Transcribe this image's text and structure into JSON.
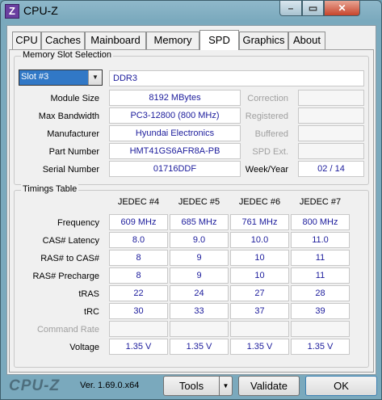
{
  "window": {
    "title": "CPU-Z",
    "icon_letter": "Z"
  },
  "window_controls": {
    "minimize": "–",
    "maximize": "▭",
    "close": "✕"
  },
  "tabs": [
    "CPU",
    "Caches",
    "Mainboard",
    "Memory",
    "SPD",
    "Graphics",
    "About"
  ],
  "active_tab": "SPD",
  "memory_slot": {
    "group_title": "Memory Slot Selection",
    "slot_selected": "Slot #3",
    "type": "DDR3",
    "rows": [
      {
        "label": "Module Size",
        "value": "8192 MBytes"
      },
      {
        "label": "Max Bandwidth",
        "value": "PC3-12800 (800 MHz)"
      },
      {
        "label": "Manufacturer",
        "value": "Hyundai Electronics"
      },
      {
        "label": "Part Number",
        "value": "HMT41GS6AFR8A-PB"
      },
      {
        "label": "Serial Number",
        "value": "01716DDF"
      }
    ],
    "right_rows": [
      {
        "label": "Correction",
        "value": ""
      },
      {
        "label": "Registered",
        "value": ""
      },
      {
        "label": "Buffered",
        "value": ""
      },
      {
        "label": "SPD Ext.",
        "value": ""
      },
      {
        "label": "Week/Year",
        "value": "02 / 14"
      }
    ]
  },
  "timings": {
    "group_title": "Timings Table",
    "columns": [
      "JEDEC #4",
      "JEDEC #5",
      "JEDEC #6",
      "JEDEC #7"
    ],
    "rows": [
      {
        "label": "Frequency",
        "values": [
          "609 MHz",
          "685 MHz",
          "761 MHz",
          "800 MHz"
        ]
      },
      {
        "label": "CAS# Latency",
        "values": [
          "8.0",
          "9.0",
          "10.0",
          "11.0"
        ]
      },
      {
        "label": "RAS# to CAS#",
        "values": [
          "8",
          "9",
          "10",
          "11"
        ]
      },
      {
        "label": "RAS# Precharge",
        "values": [
          "8",
          "9",
          "10",
          "11"
        ]
      },
      {
        "label": "tRAS",
        "values": [
          "22",
          "24",
          "27",
          "28"
        ]
      },
      {
        "label": "tRC",
        "values": [
          "30",
          "33",
          "37",
          "39"
        ]
      },
      {
        "label": "Command Rate",
        "values": [
          "",
          "",
          "",
          ""
        ]
      },
      {
        "label": "Voltage",
        "values": [
          "1.35 V",
          "1.35 V",
          "1.35 V",
          "1.35 V"
        ]
      }
    ]
  },
  "footer": {
    "brand": "CPU-Z",
    "version": "Ver. 1.69.0.x64",
    "tools_label": "Tools",
    "tools_arrow": "▼",
    "validate_label": "Validate",
    "ok_label": "OK"
  }
}
